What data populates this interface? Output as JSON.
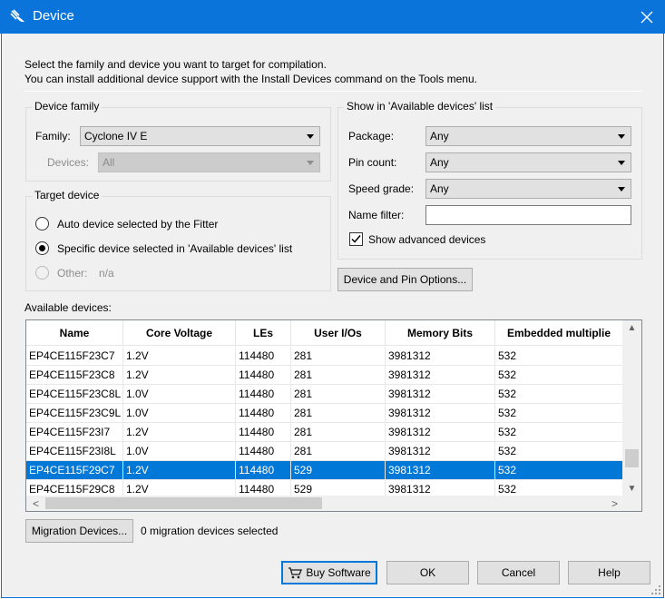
{
  "window": {
    "title": "Device"
  },
  "intro": {
    "line1": "Select the family and device you want to target for compilation.",
    "line2": "You can install additional device support with the Install Devices command on the Tools menu."
  },
  "device_family": {
    "title": "Device family",
    "family_label": "Family:",
    "family_value": "Cyclone IV E",
    "devices_label": "Devices:",
    "devices_value": "All"
  },
  "target_device": {
    "title": "Target device",
    "auto": "Auto device selected by the Fitter",
    "specific": "Specific device selected in 'Available devices' list",
    "other_label": "Other:",
    "other_value": "n/a"
  },
  "show_in": {
    "title": "Show in 'Available devices' list",
    "package_label": "Package:",
    "package_value": "Any",
    "pin_count_label": "Pin count:",
    "pin_count_value": "Any",
    "speed_grade_label": "Speed grade:",
    "speed_grade_value": "Any",
    "name_filter_label": "Name filter:",
    "name_filter_value": "",
    "show_advanced": "Show advanced devices"
  },
  "device_pin_options": "Device and Pin Options...",
  "available": {
    "label": "Available devices:",
    "columns": [
      "Name",
      "Core Voltage",
      "LEs",
      "User I/Os",
      "Memory Bits",
      "Embedded multiplie"
    ],
    "rows": [
      [
        "EP4CE115F23C7",
        "1.2V",
        "114480",
        "281",
        "3981312",
        "532"
      ],
      [
        "EP4CE115F23C8",
        "1.2V",
        "114480",
        "281",
        "3981312",
        "532"
      ],
      [
        "EP4CE115F23C8L",
        "1.0V",
        "114480",
        "281",
        "3981312",
        "532"
      ],
      [
        "EP4CE115F23C9L",
        "1.0V",
        "114480",
        "281",
        "3981312",
        "532"
      ],
      [
        "EP4CE115F23I7",
        "1.2V",
        "114480",
        "281",
        "3981312",
        "532"
      ],
      [
        "EP4CE115F23I8L",
        "1.0V",
        "114480",
        "281",
        "3981312",
        "532"
      ],
      [
        "EP4CE115F29C7",
        "1.2V",
        "114480",
        "529",
        "3981312",
        "532"
      ],
      [
        "EP4CE115F29C8",
        "1.2V",
        "114480",
        "529",
        "3981312",
        "532"
      ]
    ],
    "selected_row": 6
  },
  "migration": {
    "button": "Migration Devices...",
    "status": "0 migration devices selected"
  },
  "footer": {
    "buy": "Buy Software",
    "ok": "OK",
    "cancel": "Cancel",
    "help": "Help"
  }
}
